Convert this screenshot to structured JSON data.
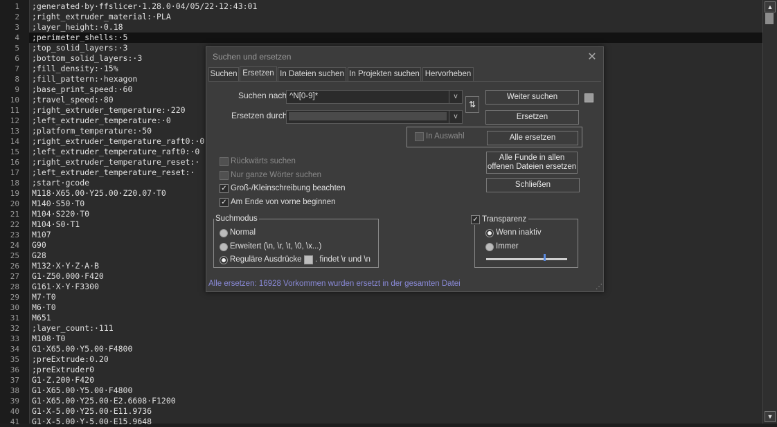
{
  "editor": {
    "lines": [
      {
        "n": "1",
        "t": ";generated·by·ffslicer·1.28.0·04/05/22·12:43:01"
      },
      {
        "n": "2",
        "t": ";right_extruder_material:·PLA"
      },
      {
        "n": "3",
        "t": ";layer_height:·0.18"
      },
      {
        "n": "4",
        "t": ";perimeter_shells:·5"
      },
      {
        "n": "5",
        "t": ";top_solid_layers:·3"
      },
      {
        "n": "6",
        "t": ";bottom_solid_layers:·3"
      },
      {
        "n": "7",
        "t": ";fill_density:·15%"
      },
      {
        "n": "8",
        "t": ";fill_pattern:·hexagon"
      },
      {
        "n": "9",
        "t": ";base_print_speed:·60"
      },
      {
        "n": "10",
        "t": ";travel_speed:·80"
      },
      {
        "n": "11",
        "t": ";right_extruder_temperature:·220"
      },
      {
        "n": "12",
        "t": ";left_extruder_temperature:·0"
      },
      {
        "n": "13",
        "t": ";platform_temperature:·50"
      },
      {
        "n": "14",
        "t": ";right_extruder_temperature_raft0:·0"
      },
      {
        "n": "15",
        "t": ";left_extruder_temperature_raft0:·0"
      },
      {
        "n": "16",
        "t": ";right_extruder_temperature_reset:·"
      },
      {
        "n": "17",
        "t": ";left_extruder_temperature_reset:·"
      },
      {
        "n": "18",
        "t": ";start·gcode"
      },
      {
        "n": "19",
        "t": "M118·X65.00·Y25.00·Z20.07·T0"
      },
      {
        "n": "20",
        "t": "M140·S50·T0"
      },
      {
        "n": "21",
        "t": "M104·S220·T0"
      },
      {
        "n": "22",
        "t": "M104·S0·T1"
      },
      {
        "n": "23",
        "t": "M107"
      },
      {
        "n": "24",
        "t": "G90"
      },
      {
        "n": "25",
        "t": "G28"
      },
      {
        "n": "26",
        "t": "M132·X·Y·Z·A·B"
      },
      {
        "n": "27",
        "t": "G1·Z50.000·F420"
      },
      {
        "n": "28",
        "t": "G161·X·Y·F3300"
      },
      {
        "n": "29",
        "t": "M7·T0"
      },
      {
        "n": "30",
        "t": "M6·T0"
      },
      {
        "n": "31",
        "t": "M651"
      },
      {
        "n": "32",
        "t": ";layer_count:·111"
      },
      {
        "n": "33",
        "t": "M108·T0"
      },
      {
        "n": "34",
        "t": "G1·X65.00·Y5.00·F4800"
      },
      {
        "n": "35",
        "t": ";preExtrude:0.20"
      },
      {
        "n": "36",
        "t": ";preExtruder0"
      },
      {
        "n": "37",
        "t": "G1·Z.200·F420"
      },
      {
        "n": "38",
        "t": "G1·X65.00·Y5.00·F4800"
      },
      {
        "n": "39",
        "t": "G1·X65.00·Y25.00·E2.6608·F1200"
      },
      {
        "n": "40",
        "t": "G1·X-5.00·Y25.00·E11.9736"
      },
      {
        "n": "41",
        "t": "G1·X-5.00·Y-5.00·E15.9648"
      }
    ],
    "current_line": "4"
  },
  "scrollbar": {
    "up": "▲",
    "down": "▼"
  },
  "dialog": {
    "title": "Suchen und ersetzen",
    "close": "✕",
    "tabs": [
      "Suchen",
      "Ersetzen",
      "In Dateien suchen",
      "In Projekten suchen",
      "Hervorheben"
    ],
    "active_tab": "Ersetzen",
    "find_label": "Suchen nach:",
    "find_value": "^N[0-9]*",
    "replace_label": "Ersetzen durch:",
    "replace_value": "",
    "dropdown": "v",
    "swap": "⇅",
    "buttons": {
      "find_next": "Weiter suchen",
      "replace": "Ersetzen",
      "replace_all": "Alle ersetzen",
      "replace_all_open": "Alle Funde in allen offenen Dateien ersetzen",
      "close": "Schließen"
    },
    "in_selection": "In Auswahl",
    "options": [
      {
        "label": "Rückwärts suchen",
        "checked": false,
        "enabled": false
      },
      {
        "label": "Nur ganze Wörter suchen",
        "checked": false,
        "enabled": false
      },
      {
        "label": "Groß-/Kleinschreibung beachten",
        "checked": true,
        "enabled": true
      },
      {
        "label": "Am Ende von vorne beginnen",
        "checked": true,
        "enabled": true
      }
    ],
    "search_mode": {
      "legend": "Suchmodus",
      "normal": "Normal",
      "extended": "Erweitert (\\n, \\r, \\t, \\0, \\x...)",
      "regex": "Reguläre Ausdrücke",
      "dot_matches": ". findet \\r und \\n",
      "selected": "regex"
    },
    "transparency": {
      "label": "Transparenz",
      "checked": true,
      "when_inactive": "Wenn inaktiv",
      "always": "Immer",
      "selected": "when_inactive",
      "level": 0.72
    },
    "status": "Alle ersetzen: 16928 Vorkommen wurden ersetzt in der gesamten Datei",
    "check_mark": "✓",
    "grip": "⋰"
  }
}
